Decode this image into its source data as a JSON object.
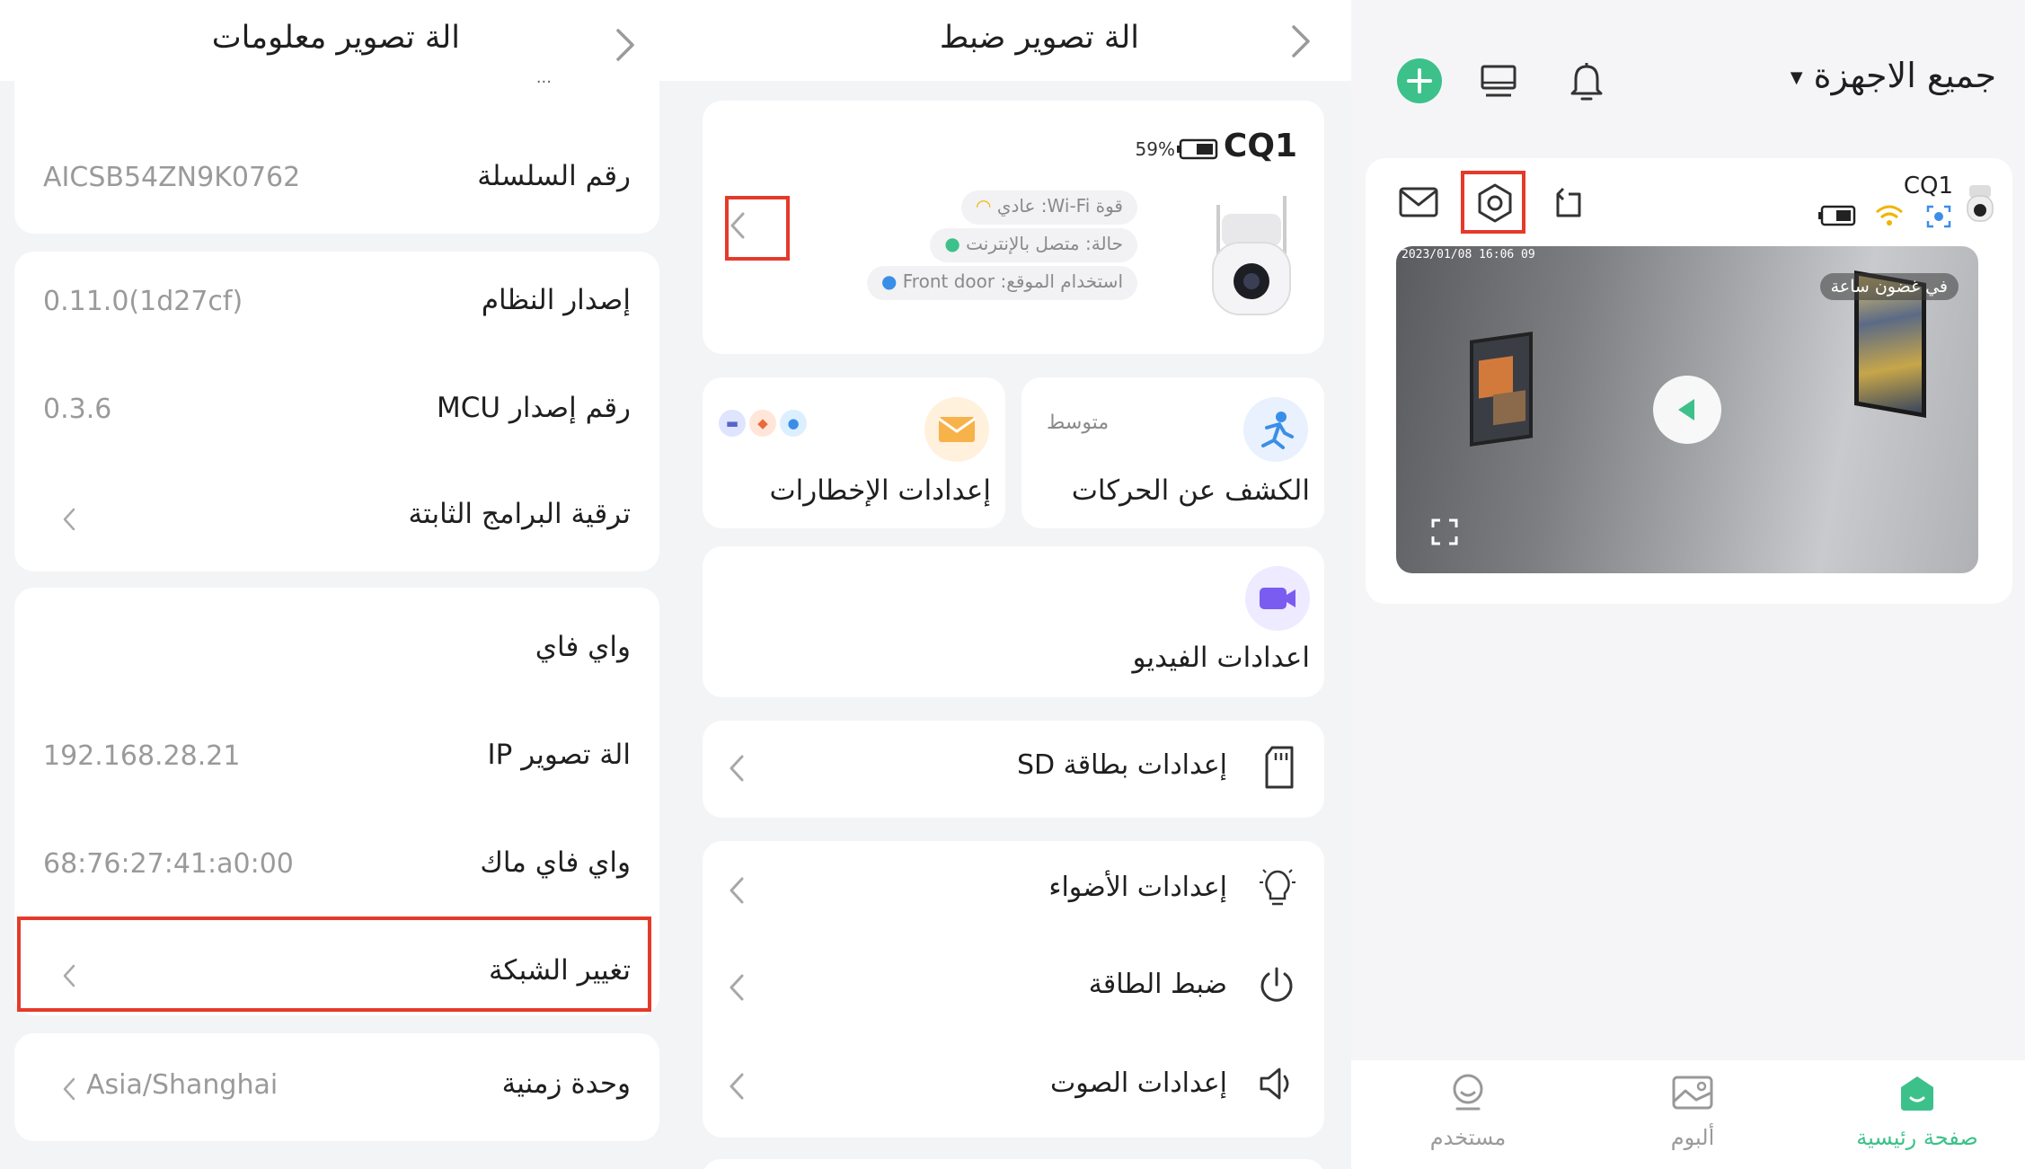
{
  "info_panel": {
    "title": "الة تصوير معلومات",
    "partial_text": "...",
    "rows": {
      "serial_label": "رقم السلسلة",
      "serial_value": "AICSB54ZN9K0762",
      "system_version_label": "إصدار النظام",
      "system_version_value": "0.11.0(1d27cf)",
      "mcu_label": "رقم إصدار MCU",
      "mcu_value": "0.3.6",
      "firmware_label": "ترقية البرامج الثابتة",
      "wifi_label": "واي فاي",
      "ip_label": "الة تصوير IP",
      "ip_value": "192.168.28.21",
      "mac_label": "واي فاي ماك",
      "mac_value": "68:76:27:41:a0:00",
      "change_network_label": "تغيير الشبكة",
      "timezone_label": "وحدة زمنية",
      "timezone_value": "Asia/Shanghai"
    }
  },
  "settings_panel": {
    "title": "الة تصوير ضبط",
    "device": {
      "name": "CQ1",
      "battery": "59%",
      "wifi_strength": "قوة Wi-Fi: عادي",
      "status": "حالة: متصل بالإنترنت",
      "location": "استخدام الموقع: Front door"
    },
    "motion": {
      "label": "الكشف عن الحركات",
      "level": "متوسط"
    },
    "alerts": {
      "label": "إعدادات الإخطارات"
    },
    "video": {
      "label": "اعدادات الفيديو"
    },
    "sd_card": {
      "label": "إعدادات بطاقة SD"
    },
    "lights": {
      "label": "إعدادات الأضواء"
    },
    "power": {
      "label": "ضبط الطاقة"
    },
    "sound": {
      "label": "إعدادات الصوت"
    }
  },
  "home_panel": {
    "title": "جميع الاجهزة",
    "device_name": "CQ1",
    "timestamp": "2023/01/08 16:06 09",
    "preview_badge": "في غضون ساعة",
    "nav": {
      "home": "صفحة رئيسية",
      "album": "ألبوم",
      "user": "مستخدم"
    }
  },
  "colors": {
    "accent_green": "#3cc18a",
    "highlight_red": "#e53a2a",
    "motion_blue": "#3a8ee8",
    "alert_orange": "#f7b24a",
    "video_purple": "#7b5cf0"
  }
}
